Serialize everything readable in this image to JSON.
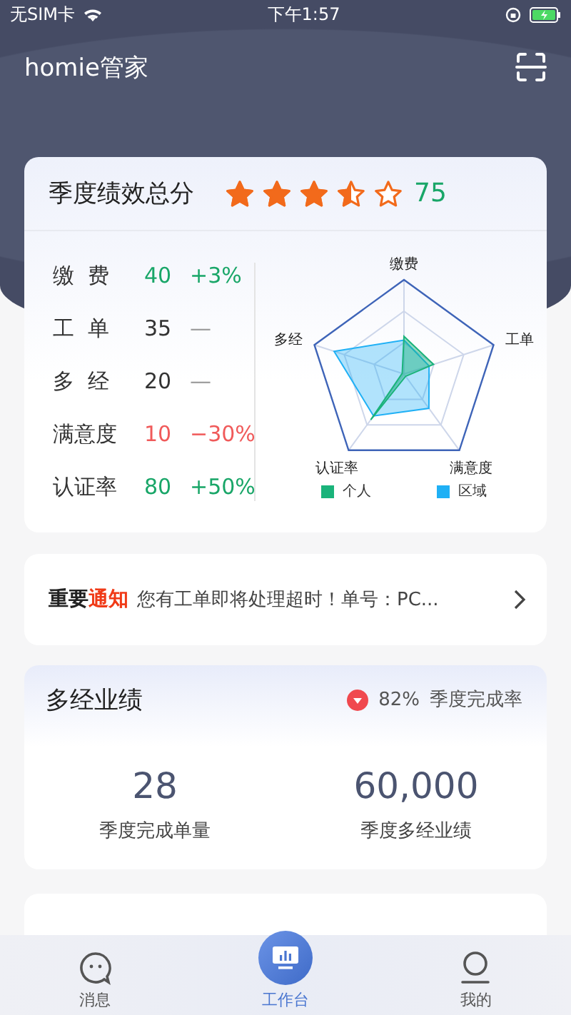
{
  "status_bar": {
    "carrier": "无SIM卡",
    "time": "下午1:57"
  },
  "header": {
    "title": "homie管家"
  },
  "score_card": {
    "title": "季度绩效总分",
    "stars": 3.5,
    "score": "75",
    "metrics": [
      {
        "label": "缴  费",
        "value": "40",
        "change": "+3%",
        "kind": "up"
      },
      {
        "label": "工  单",
        "value": "35",
        "change": "—",
        "kind": "flat"
      },
      {
        "label": "多  经",
        "value": "20",
        "change": "—",
        "kind": "flat"
      },
      {
        "label": "满意度",
        "value": "10",
        "change": "−30%",
        "kind": "down"
      },
      {
        "label": "认证率",
        "value": "80",
        "change": "+50%",
        "kind": "up"
      }
    ],
    "radar": {
      "axes": [
        "缴费",
        "工单",
        "满意度",
        "认证率",
        "多经"
      ],
      "legend": [
        {
          "name": "个人",
          "color": "#1ab37a"
        },
        {
          "name": "区域",
          "color": "#1fb0f5"
        }
      ]
    }
  },
  "notice": {
    "label_dark": "重要",
    "label_red": "通知",
    "text": "您有工单即将处理超时！单号：PC..."
  },
  "business": {
    "title": "多经业绩",
    "rate": "82%",
    "rate_label": "季度完成率",
    "stats": [
      {
        "value": "28",
        "label": "季度完成单量"
      },
      {
        "value": "60,000",
        "label": "季度多经业绩"
      }
    ]
  },
  "tabs": [
    {
      "label": "消息",
      "selected": false
    },
    {
      "label": "工作台",
      "selected": true
    },
    {
      "label": "我的",
      "selected": false
    }
  ]
}
